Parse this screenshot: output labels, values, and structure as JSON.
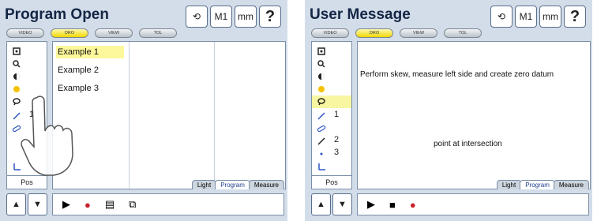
{
  "left": {
    "title": "Program Open",
    "top_buttons": {
      "undo": "⟲",
      "m1": "M1",
      "mm": "mm",
      "help": "?"
    },
    "tabs": [
      "VIDEO",
      "DRO",
      "VIEW",
      "TOL"
    ],
    "list": [
      "Example 1",
      "Example 2",
      "Example 3"
    ],
    "tool_number": "1",
    "pos_label": "Pos",
    "bottom_tabs": [
      "Light",
      "Program",
      "Measure"
    ],
    "controls": [
      "▶",
      "●",
      "▤",
      "⧉"
    ]
  },
  "right": {
    "title": "User Message",
    "top_buttons": {
      "undo": "⟲",
      "m1": "M1",
      "mm": "mm",
      "help": "?"
    },
    "tabs": [
      "VIDEO",
      "DRO",
      "VIEW",
      "TOL"
    ],
    "message_line1": "Perform skew, measure left side and create zero datum",
    "message_line2": "point at intersection",
    "tool_numbers": [
      "1",
      "2",
      "3"
    ],
    "pos_label": "Pos",
    "bottom_tabs": [
      "Light",
      "Program",
      "Measure"
    ],
    "controls": [
      "▶",
      "■",
      "●"
    ]
  },
  "colors": {
    "panel_bg": "#d2dde9",
    "highlight": "#fdf89b",
    "dro_tab": "#f0d800",
    "record": "#c8232c",
    "text": "#142645"
  }
}
